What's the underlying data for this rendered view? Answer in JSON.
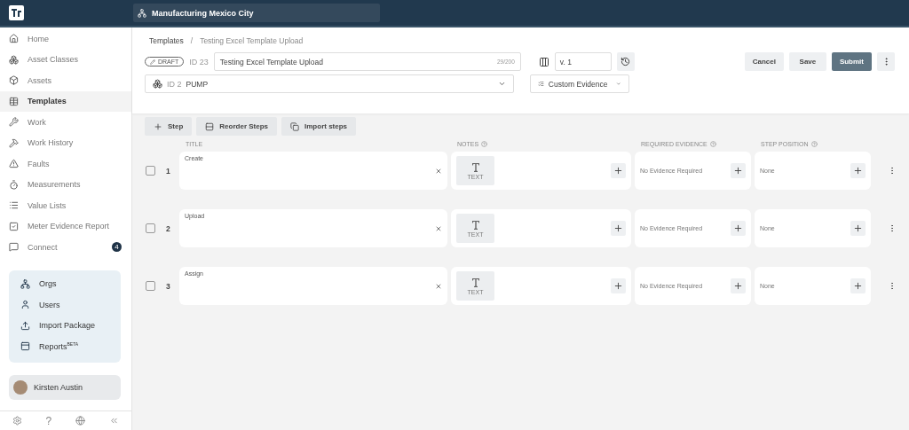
{
  "topbar": {
    "org": "Manufacturing Mexico City"
  },
  "sidebar": {
    "items": [
      {
        "label": "Home",
        "selected": false
      },
      {
        "label": "Asset Classes",
        "selected": false
      },
      {
        "label": "Assets",
        "selected": false
      },
      {
        "label": "Templates",
        "selected": true
      },
      {
        "label": "Work",
        "selected": false
      },
      {
        "label": "Work History",
        "selected": false
      },
      {
        "label": "Faults",
        "selected": false
      },
      {
        "label": "Measurements",
        "selected": false
      },
      {
        "label": "Value Lists",
        "selected": false
      },
      {
        "label": "Meter Evidence Report",
        "selected": false
      },
      {
        "label": "Connect",
        "selected": false,
        "badge": "4"
      }
    ],
    "admin_items": [
      {
        "label": "Orgs"
      },
      {
        "label": "Users"
      },
      {
        "label": "Import Package"
      },
      {
        "label": "Reports$^{BETA}$"
      }
    ],
    "user": {
      "name": "Kirsten Austin"
    },
    "footer": {
      "help": "?"
    }
  },
  "breadcrumb": {
    "separator": "/",
    "items": [
      "Templates",
      "Testing Excel Template Upload"
    ]
  },
  "template": {
    "status": "DRAFT",
    "id": "ID 23",
    "title": "Testing Excel Template Upload",
    "counter": "29/200",
    "version": "v. 1",
    "asset_id": "ID 2",
    "asset": "PUMP",
    "evidence_mode": "Custom Evidence"
  },
  "actions": [
    {
      "label": "Cancel",
      "kind": "secondary"
    },
    {
      "label": "Save",
      "kind": "secondary"
    },
    {
      "label": "Submit",
      "kind": "primary"
    }
  ],
  "toolbar": [
    "Step",
    "Reorder Steps",
    "Import steps"
  ],
  "columns": [
    "TITLE",
    "NOTES",
    "REQUIRED EVIDENCE",
    "STEP POSITION"
  ],
  "steps": [
    {
      "number": "1",
      "title": "Create",
      "checked": false,
      "note_type": "TEXT",
      "evidence": "No Evidence Required",
      "position": "None"
    },
    {
      "number": "2",
      "title": "Upload",
      "checked": false,
      "note_type": "TEXT",
      "evidence": "No Evidence Required",
      "position": "None"
    },
    {
      "number": "3",
      "title": "Assign",
      "checked": false,
      "note_type": "TEXT",
      "evidence": "No Evidence Required",
      "position": "None"
    }
  ]
}
